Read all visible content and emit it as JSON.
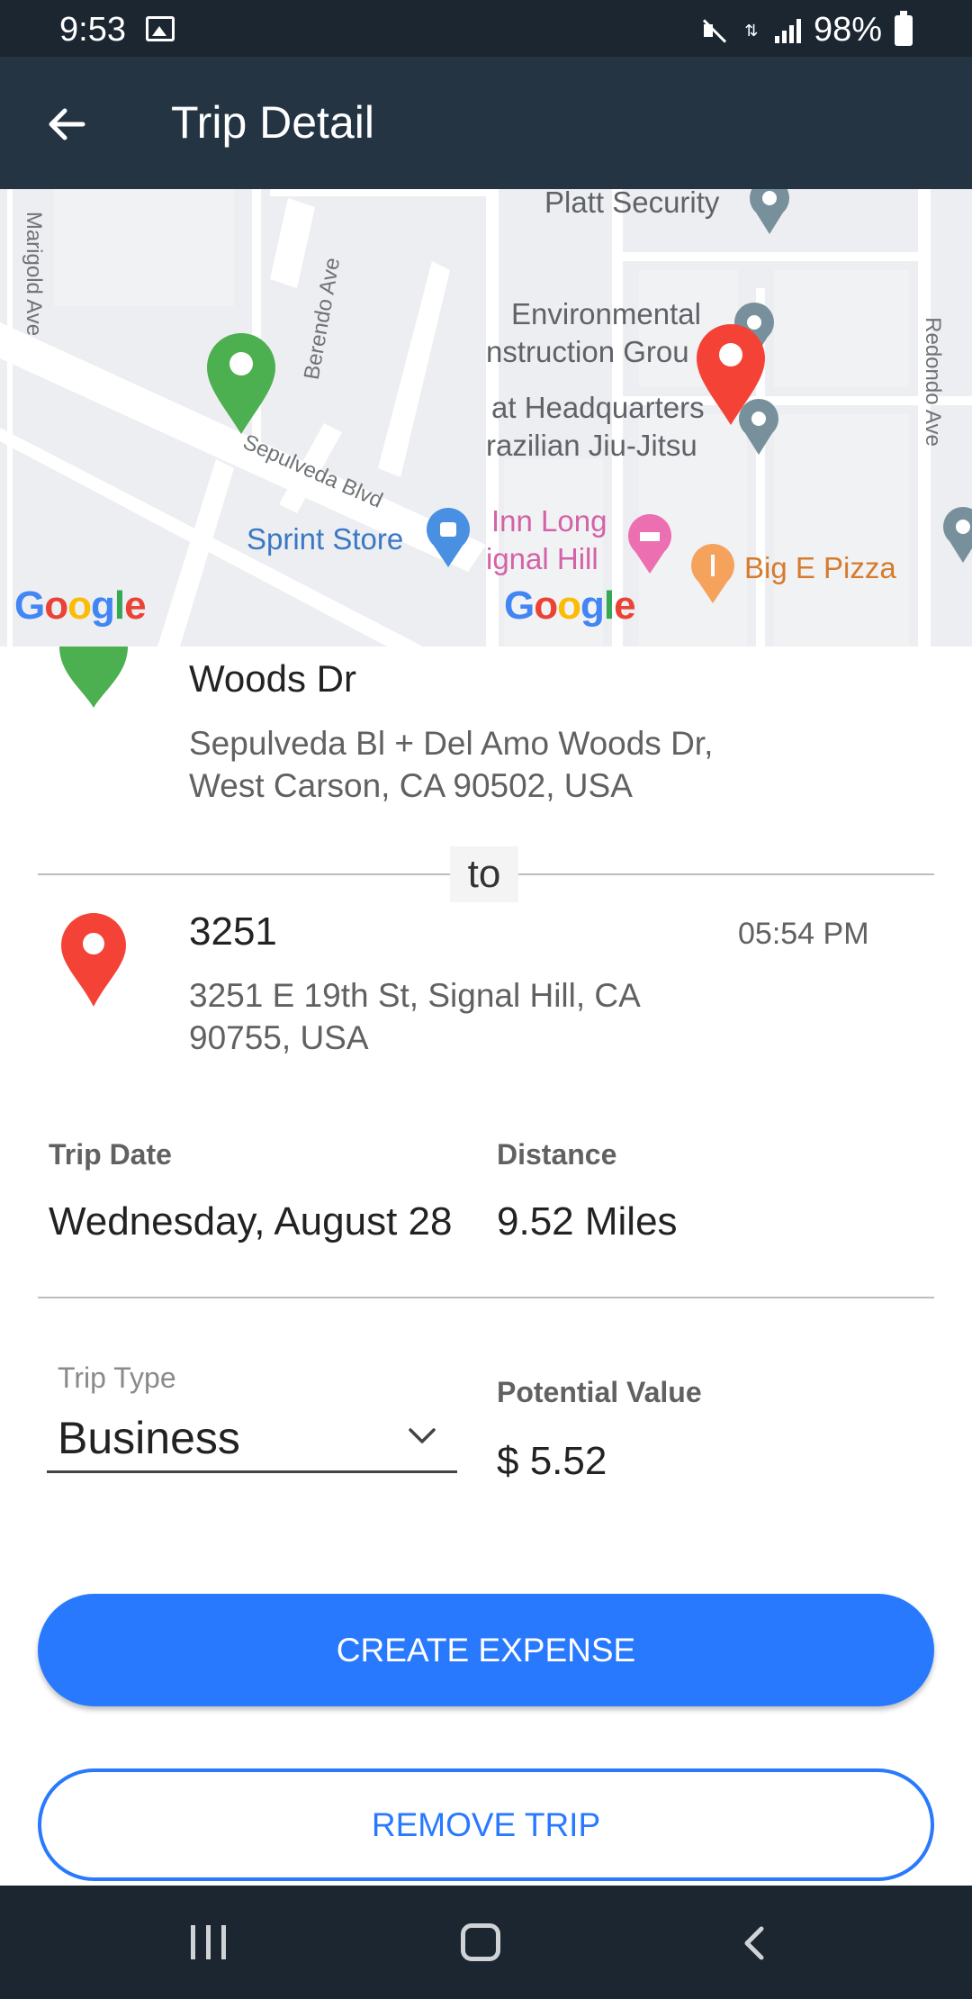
{
  "status_bar": {
    "time": "9:53",
    "battery": "98%"
  },
  "app_bar": {
    "title": "Trip Detail"
  },
  "map": {
    "labels": {
      "platt_security": "Platt Security",
      "environmental_1": "Environmental",
      "environmental_2": "nstruction Grou",
      "headquarters_1": "at Headquarters",
      "headquarters_2": "razilian Jiu-Jitsu",
      "sprint_store": "Sprint Store",
      "inn_long_1": "Inn Long",
      "inn_long_2": "ignal Hill",
      "big_e_pizza": "Big E Pizza"
    },
    "streets": {
      "marigold": "Marigold Ave",
      "berendo": "Berendo Ave",
      "sepulveda": "Sepulveda Blvd",
      "redondo": "Redondo Ave"
    },
    "logo": "Google",
    "colors": {
      "origin_pin": "#4caf50",
      "destination_pin": "#f44336"
    }
  },
  "trip": {
    "origin": {
      "title": "Woods Dr",
      "address": "Sepulveda Bl + Del Amo Woods Dr, West Carson, CA 90502, USA"
    },
    "separator": "to",
    "destination": {
      "title": "3251",
      "time": "05:54 PM",
      "address": "3251 E 19th St, Signal Hill, CA 90755, USA"
    },
    "date_label": "Trip Date",
    "date_value": "Wednesday, August 28",
    "distance_label": "Distance",
    "distance_value": "9.52 Miles",
    "type_label": "Trip Type",
    "type_value": "Business",
    "value_label": "Potential Value",
    "value_value": "$ 5.52"
  },
  "actions": {
    "create_expense": "CREATE EXPENSE",
    "remove_trip": "REMOVE TRIP"
  },
  "theme": {
    "accent": "#2979ff",
    "app_bar": "#243443"
  }
}
